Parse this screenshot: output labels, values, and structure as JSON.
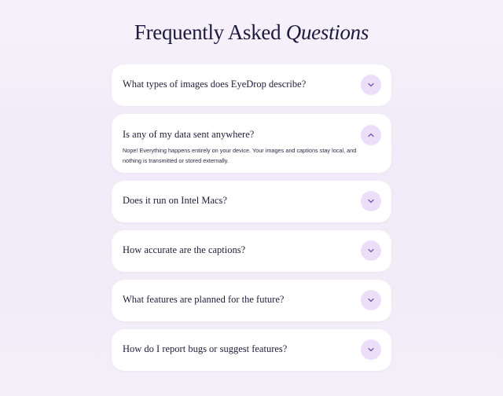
{
  "header": {
    "title_plain": "Frequently Asked",
    "title_italic": "Questions"
  },
  "colors": {
    "toggle_bg": "#ecdef9",
    "chevron": "#6b3fa8",
    "card_bg": "#ffffff"
  },
  "faq": [
    {
      "question": "What types of images does EyeDrop describe?",
      "expanded": false,
      "icon": "chevron-down-icon"
    },
    {
      "question": "Is any of my data sent anywhere?",
      "expanded": true,
      "icon": "chevron-up-icon",
      "answer": "Nope! Everything happens entirely on your device. Your images and captions stay local, and nothing is transmitted or stored externally."
    },
    {
      "question": "Does it run on Intel Macs?",
      "expanded": false,
      "icon": "chevron-down-icon"
    },
    {
      "question": "How accurate are the captions?",
      "expanded": false,
      "icon": "chevron-down-icon"
    },
    {
      "question": "What features are planned for the future?",
      "expanded": false,
      "icon": "chevron-down-icon"
    },
    {
      "question": "How do I report bugs or suggest features?",
      "expanded": false,
      "icon": "chevron-down-icon"
    }
  ]
}
